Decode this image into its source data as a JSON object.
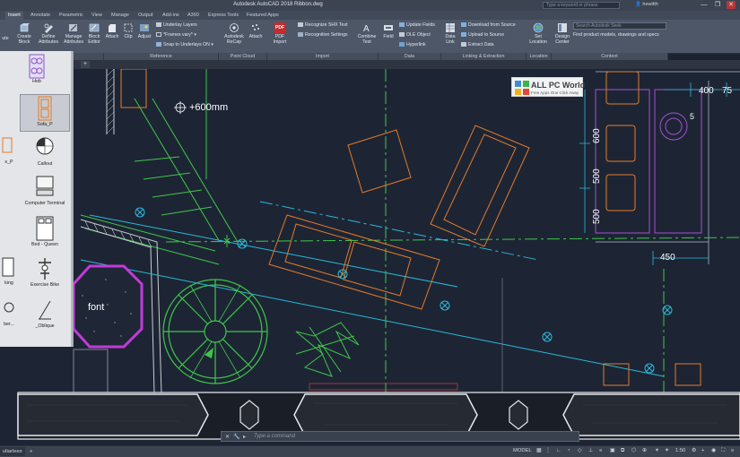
{
  "window": {
    "title": "Autodesk AutoCAD 2018    Ribbon.dwg",
    "search_placeholder": "Type a keyword or phrase",
    "user": "hewitth",
    "controls": [
      "—",
      "❐",
      "✕"
    ]
  },
  "tabs": [
    "Insert",
    "Annotate",
    "Parametric",
    "View",
    "Manage",
    "Output",
    "Add-ins",
    "A360",
    "Express Tools",
    "Featured Apps"
  ],
  "active_tab": "Insert",
  "ribbon": {
    "block": {
      "create_block": "Create Block",
      "define_attributes": "Define Attributes",
      "manage_attributes": "Manage Attributes",
      "block_editor": "Block Editor"
    },
    "reference": {
      "attach": "Attach",
      "clip": "Clip",
      "adjust": "Adjust",
      "underlay_layers": "Underlay Layers",
      "frames_vary": "*Frames vary*",
      "snap_to_underlays": "Snap to Underlays ON",
      "panel_label": "Reference"
    },
    "point_cloud": {
      "autodesk_recap": "Autodesk ReCap",
      "attach": "Attach",
      "panel_label": "Point Cloud"
    },
    "import": {
      "pdf_import": "PDF Import",
      "pdf_badge": "PDF",
      "recognize_shx_text": "Recognize SHX Text",
      "recognition_settings": "Recognition Settings",
      "combine_text": "Combine Text",
      "panel_label": "Import"
    },
    "data": {
      "field": "Field",
      "update_fields": "Update Fields",
      "ole_object": "OLE Object",
      "hyperlink": "Hyperlink",
      "data_link": "Data Link",
      "panel_label": "Data"
    },
    "linking": {
      "download_from_source": "Download from Source",
      "upload_to_source": "Upload to Source",
      "extract_data": "Extract  Data",
      "panel_label": "Linking & Extraction"
    },
    "location": {
      "set_location": "Set Location",
      "panel_label": "Location"
    },
    "content": {
      "design_center": "Design Center",
      "search_placeholder": "Search Autodesk Seek",
      "find_text": "Find product models, drawings and specs",
      "panel_label": "Content"
    },
    "partial_left": "ute"
  },
  "palette": {
    "items": [
      {
        "label": "Hob"
      },
      {
        "label": "Sofa_P"
      },
      {
        "label": "Callout"
      },
      {
        "label": "Computer Terminal"
      },
      {
        "label": "Bed - Queen"
      },
      {
        "label": "Exercise Bike"
      },
      {
        "label": "_Oblique"
      }
    ],
    "left_fragments": [
      "s_P",
      "king",
      "ber..."
    ]
  },
  "watermark": {
    "title": "ALL PC World",
    "subtitle": "Free Apps One Click Away"
  },
  "drawing": {
    "label_600": "+600mm",
    "label_font": "font",
    "dim_400": "400",
    "dim_450": "450",
    "dim_500_a": "500",
    "dim_500_b": "500",
    "dim_600": "600",
    "dim_5": "5",
    "dim_75": "75"
  },
  "command_line": {
    "prompt": "Type a command"
  },
  "status_bar": {
    "layouts_label": "Layout1",
    "layouts_fragment": "uliarlees",
    "model": "MODEL",
    "scale": "1:50"
  }
}
